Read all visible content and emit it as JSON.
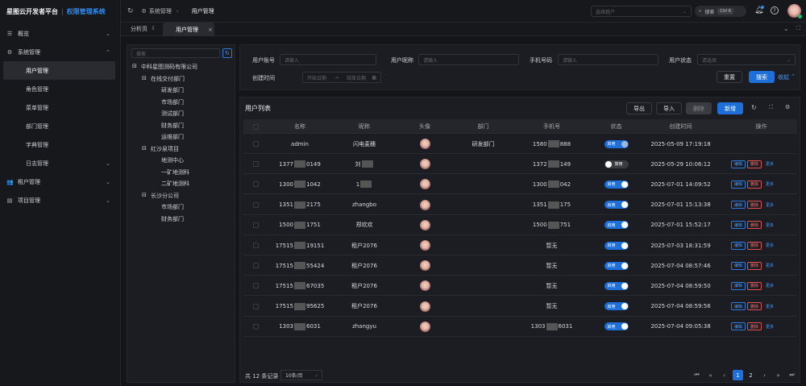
{
  "brand": {
    "title": "星图云开发者平台",
    "sep": "|",
    "system": "权限管理系统"
  },
  "menu": {
    "overview": "概览",
    "system": "系统管理",
    "user": "用户管理",
    "role": "角色管理",
    "menu": "菜单管理",
    "dept": "部门管理",
    "dict": "字典管理",
    "log": "日志管理",
    "tenant": "租户管理",
    "project": "项目管理"
  },
  "topbar": {
    "crumb1": "系统管理",
    "crumb2": "用户管理",
    "tenant_placeholder": "选择租户",
    "search": "搜索",
    "shortcut": "Ctrl K"
  },
  "tabs": {
    "t1": "分析页",
    "t2": "用户管理"
  },
  "tree": {
    "search_placeholder": "搜索",
    "root": "中科星图测码有限公司",
    "n1": "在线交付部门",
    "n1a": "研发部门",
    "n1b": "市场部门",
    "n1c": "测试部门",
    "n1d": "财务部门",
    "n1e": "运维部门",
    "n2": "红沙泉项目",
    "n2a": "地测中心",
    "n2b": "一矿地测科",
    "n2c": "二矿地测科",
    "n3": "长沙分公司",
    "n3a": "市场部门",
    "n3b": "财务部门"
  },
  "filter": {
    "account": "用户账号",
    "account_ph": "请输入",
    "nick": "用户昵称",
    "nick_ph": "请输入",
    "phone": "手机号码",
    "phone_ph": "请输入",
    "status": "用户状态",
    "status_ph": "请选择",
    "ctime": "创建时间",
    "start_ph": "开始日期",
    "end_ph": "结束日期",
    "reset": "重置",
    "search": "搜索",
    "collapse": "收起"
  },
  "table": {
    "title": "用户列表",
    "export": "导出",
    "import": "导入",
    "delete": "删除",
    "add": "新增",
    "headers": [
      "名称",
      "昵称",
      "头像",
      "部门",
      "手机号",
      "状态",
      "创建时间",
      "操作"
    ],
    "rows": [
      {
        "name": "admin",
        "nick": "闪电麦穗",
        "dept": "研发部门",
        "phone_a": "1580",
        "phone_b": "888",
        "status": "启用",
        "on": true,
        "time": "2025-05-09 17:19:18",
        "ops": false
      },
      {
        "name_a": "1377",
        "name_b": "0149",
        "nick_a": "刘",
        "nick_b": "",
        "dept": "",
        "phone_a": "1372",
        "phone_b": "149",
        "status": "禁用",
        "on": false,
        "time": "2025-05-29 10:06:12",
        "ops": true
      },
      {
        "name_a": "1300",
        "name_b": "1042",
        "nick_a": "1",
        "nick_b": "",
        "dept": "",
        "phone_a": "1300",
        "phone_b": "042",
        "status": "启用",
        "on": true,
        "time": "2025-07-01 14:09:52",
        "ops": true
      },
      {
        "name_a": "1351",
        "name_b": "2175",
        "nick": "zhangbo",
        "dept": "",
        "phone_a": "1351",
        "phone_b": "175",
        "status": "启用",
        "on": true,
        "time": "2025-07-01 15:13:38",
        "ops": true
      },
      {
        "name_a": "1500",
        "name_b": "1751",
        "nick": "郑欢欢",
        "dept": "",
        "phone_a": "1500",
        "phone_b": "751",
        "status": "启用",
        "on": true,
        "time": "2025-07-01 15:52:17",
        "ops": true
      },
      {
        "name_a": "17515",
        "name_b": "19151",
        "nick": "租户2076",
        "dept": "",
        "phone": "暂无",
        "status": "启用",
        "on": true,
        "time": "2025-07-03 18:31:59",
        "ops": true
      },
      {
        "name_a": "17515",
        "name_b": "55424",
        "nick": "租户2076",
        "dept": "",
        "phone": "暂无",
        "status": "启用",
        "on": true,
        "time": "2025-07-04 08:57:46",
        "ops": true
      },
      {
        "name_a": "17515",
        "name_b": "67035",
        "nick": "租户2076",
        "dept": "",
        "phone": "暂无",
        "status": "启用",
        "on": true,
        "time": "2025-07-04 08:59:50",
        "ops": true
      },
      {
        "name_a": "17515",
        "name_b": "95625",
        "nick": "租户2076",
        "dept": "",
        "phone": "暂无",
        "status": "启用",
        "on": true,
        "time": "2025-07-04 08:59:56",
        "ops": true
      },
      {
        "name_a": "1303",
        "name_b": "6031",
        "nick": "zhangyu",
        "dept": "",
        "phone_a": "1303",
        "phone_b": "6031",
        "status": "启用",
        "on": true,
        "time": "2025-07-04 09:05:38",
        "ops": true
      }
    ],
    "op_edit": "编辑",
    "op_del": "删除",
    "op_more": "更多"
  },
  "pagination": {
    "total": "共 12 条记录",
    "size": "10条/页",
    "p1": "1",
    "p2": "2"
  }
}
